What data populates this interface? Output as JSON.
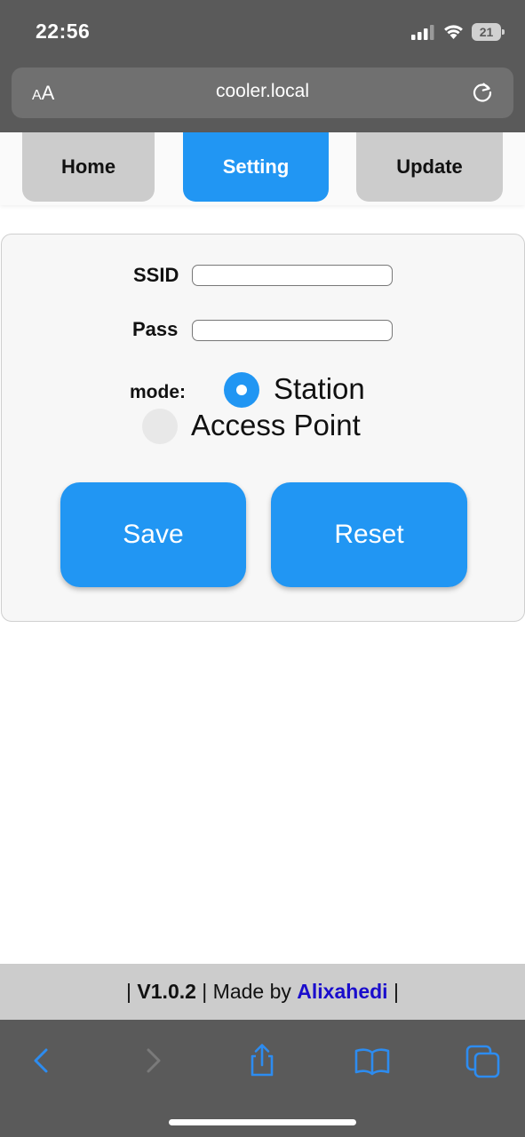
{
  "status_bar": {
    "time": "22:56",
    "battery_level": "21",
    "icons": [
      "signal-icon",
      "wifi-icon",
      "battery-icon"
    ]
  },
  "browser": {
    "text_size_button_small": "A",
    "text_size_button_large": "A",
    "url": "cooler.local",
    "reload_icon": "reload-icon",
    "toolbar_icons": [
      "back-icon",
      "forward-icon",
      "share-icon",
      "bookmarks-icon",
      "tabs-icon"
    ]
  },
  "nav": {
    "tabs": [
      {
        "label": "Home",
        "active": false
      },
      {
        "label": "Setting",
        "active": true
      },
      {
        "label": "Update",
        "active": false
      }
    ]
  },
  "form": {
    "ssid_label": "SSID",
    "ssid_value": "",
    "pass_label": "Pass",
    "pass_value": "",
    "mode_label": "mode:",
    "mode_options": [
      {
        "label": "Station",
        "selected": true
      },
      {
        "label": "Access Point",
        "selected": false
      }
    ],
    "save_label": "Save",
    "reset_label": "Reset"
  },
  "footer": {
    "prefix": "| ",
    "version": "V1.0.2",
    "middle": " | Made by ",
    "author": "Alixahedi",
    "suffix": " |"
  },
  "colors": {
    "accent": "#2196f3",
    "tab_inactive": "#cccccc",
    "chrome": "#5a5a5a",
    "author_link": "#1a0dcc"
  }
}
